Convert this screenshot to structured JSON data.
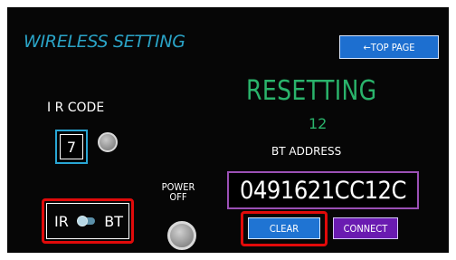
{
  "header": {
    "title": "WIRELESS SETTING",
    "top_page_label": "←TOP PAGE"
  },
  "status": {
    "message": "RESETTING",
    "count": "12"
  },
  "bt": {
    "label": "BT ADDRESS",
    "address": "0491621CC12C"
  },
  "ir": {
    "label": "I R CODE",
    "value": "7"
  },
  "power": {
    "line1": "POWER",
    "line2": "OFF"
  },
  "mode": {
    "left": "IR",
    "right": "BT",
    "selected": "BT"
  },
  "actions": {
    "clear_label": "CLEAR",
    "connect_label": "CONNECT"
  },
  "colors": {
    "title": "#2aa3c6",
    "status_green": "#2ab36b",
    "address_border": "#9a4fb4",
    "button_blue": "#1f74d3",
    "button_purple": "#6a1bb1",
    "highlight_red": "#e10a0a"
  }
}
